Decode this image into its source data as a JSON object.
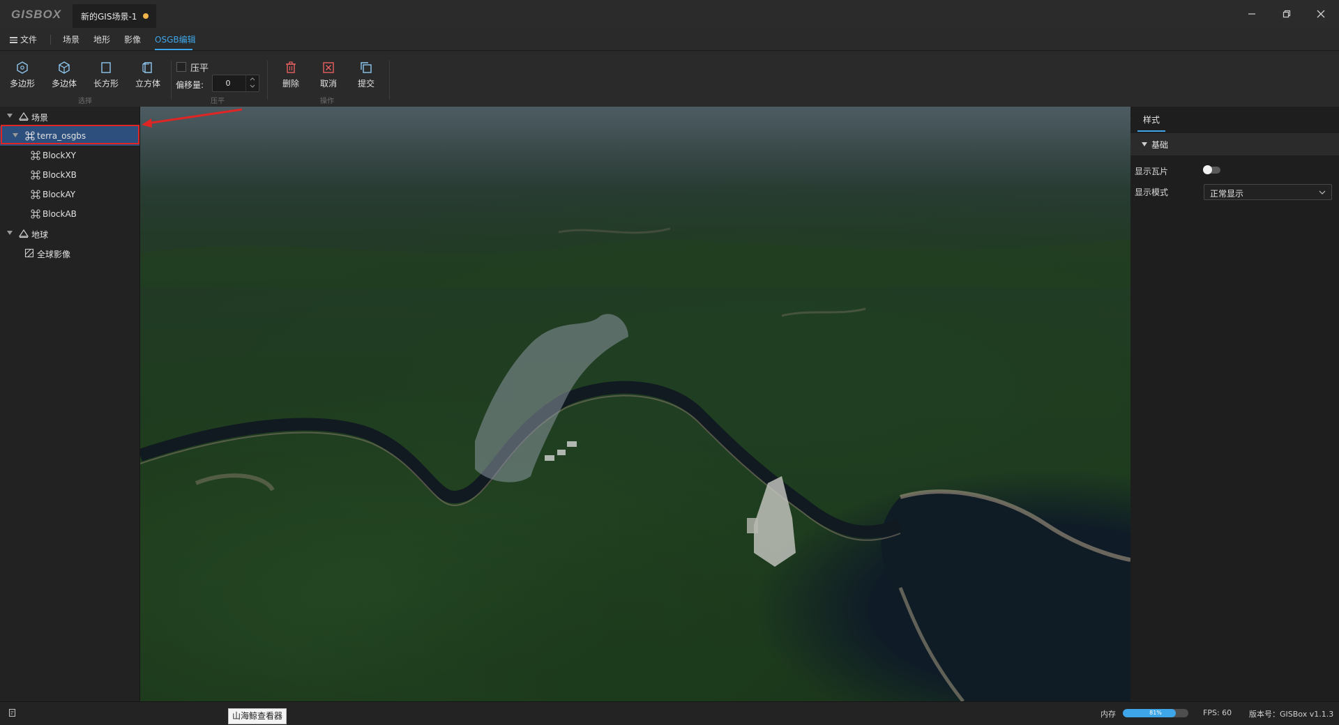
{
  "app": {
    "logo": "GISBOX",
    "document_tab": "新的GIS场景-1",
    "unsaved_dot_color": "#f0b44a"
  },
  "menu": {
    "file": "文件",
    "items": [
      "场景",
      "地形",
      "影像",
      "OSGB编辑"
    ],
    "active_index": 3
  },
  "ribbon": {
    "select_group": {
      "label": "选择",
      "buttons": [
        "多边形",
        "多边体",
        "长方形",
        "立方体"
      ]
    },
    "flatten_group": {
      "label": "压平",
      "checkbox_label": "压平",
      "checkbox_checked": false,
      "offset_label": "偏移量:",
      "offset_value": "0"
    },
    "operate_group": {
      "label": "操作",
      "buttons": [
        "删除",
        "取消",
        "提交"
      ]
    }
  },
  "tree": {
    "scene_root": "场景",
    "scene_items": {
      "model": "terra_osgbs",
      "blocks": [
        "BlockXY",
        "BlockXB",
        "BlockAY",
        "BlockAB"
      ]
    },
    "earth_root": "地球",
    "earth_items": [
      "全球影像"
    ],
    "selected": "terra_osgbs"
  },
  "right_panel": {
    "tab": "样式",
    "section": "基础",
    "show_tiles_label": "显示瓦片",
    "show_tiles_on": false,
    "display_mode_label": "显示模式",
    "display_mode_value": "正常显示"
  },
  "status": {
    "tooltip": "山海鲸查看器",
    "memory_label": "内存",
    "memory_percent_text": "81%",
    "memory_fraction": 0.81,
    "fps": "FPS: 60",
    "version": "版本号：GISBox v1.1.3"
  },
  "colors": {
    "accent": "#3ea6e8",
    "selection": "#2c4f7d",
    "annotation_red": "#e02525"
  },
  "icons": [
    "menu-icon",
    "polygon-icon",
    "polyhedron-icon",
    "rectangle-icon",
    "cube-icon",
    "trash-icon",
    "cancel-icon",
    "submit-icon",
    "scene-icon",
    "model-icon",
    "earth-icon",
    "imagery-icon",
    "status-icon",
    "chevron-down-icon"
  ]
}
